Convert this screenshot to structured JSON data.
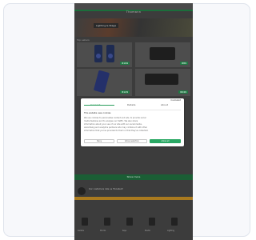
{
  "page": {
    "title": "Thomann",
    "banner_label": "Lighting & Stage",
    "section_label": "Top sellers"
  },
  "products": [
    {
      "name": "PA speaker pair",
      "price": "€199"
    },
    {
      "name": "LED flat par",
      "price": "€89"
    },
    {
      "name": "LED bar",
      "price": "€129"
    },
    {
      "name": "Light set",
      "price": "€249"
    }
  ],
  "cookie_dialog": {
    "tabs": [
      "Consent",
      "Details",
      "About"
    ],
    "active_tab": 0,
    "brand": "Cookiebot",
    "heading": "This website uses cookies",
    "lines": [
      "We use cookies to personalise content and ads, to provide social",
      "media features and to analyse our traffic. We also share",
      "information about your use of our site with our social media,",
      "advertising and analytics partners who may combine it with other",
      "information that you've provided to them or that they've collected."
    ],
    "buttons": {
      "deny": "Deny",
      "allow_selection": "Allow selection",
      "allow_all": "Allow all"
    }
  },
  "green_bar_label": "Show more",
  "review": {
    "text": "Our customers rate us 'Excellent'"
  },
  "bottom_items": [
    {
      "label": "Guitars"
    },
    {
      "label": "Drums"
    },
    {
      "label": "Keys"
    },
    {
      "label": "Studio"
    },
    {
      "label": "Lighting"
    }
  ],
  "colors": {
    "accent_green": "#2aa864",
    "dark_green": "#1b5e35",
    "orange": "#a97a1f"
  }
}
